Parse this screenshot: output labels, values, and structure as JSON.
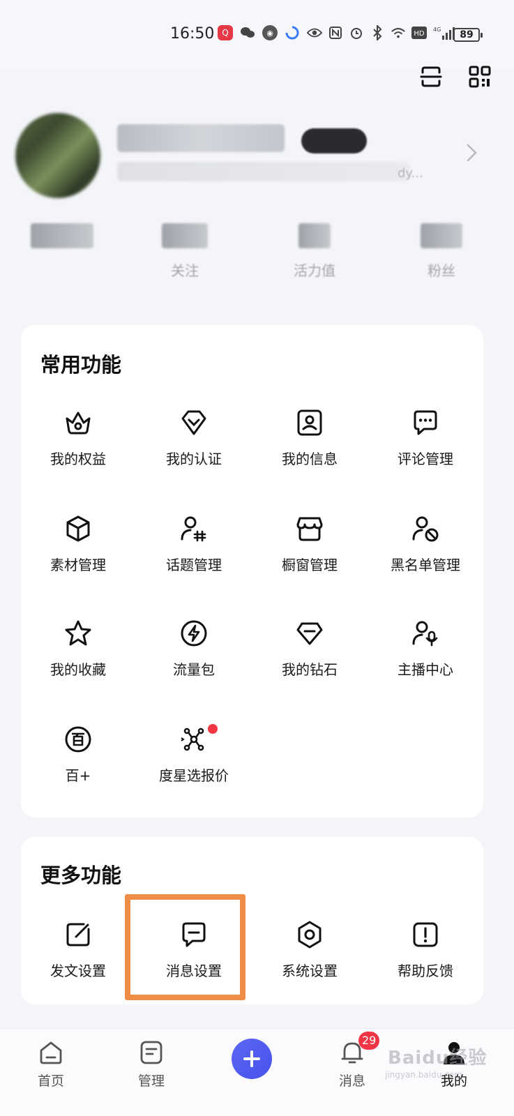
{
  "status_bar": {
    "time": "16:50",
    "battery": "89",
    "network": "4G"
  },
  "stats": [
    {
      "label": ""
    },
    {
      "label": "关注"
    },
    {
      "label": "活力值"
    },
    {
      "label": "粉丝"
    }
  ],
  "profile": {
    "bio_tail": "dy..."
  },
  "common": {
    "title": "常用功能",
    "items": [
      {
        "label": "我的权益"
      },
      {
        "label": "我的认证"
      },
      {
        "label": "我的信息"
      },
      {
        "label": "评论管理"
      },
      {
        "label": "素材管理"
      },
      {
        "label": "话题管理"
      },
      {
        "label": "橱窗管理"
      },
      {
        "label": "黑名单管理"
      },
      {
        "label": "我的收藏"
      },
      {
        "label": "流量包"
      },
      {
        "label": "我的钻石"
      },
      {
        "label": "主播中心"
      },
      {
        "label": "百+"
      },
      {
        "label": "度星选报价"
      }
    ]
  },
  "more": {
    "title": "更多功能",
    "items": [
      {
        "label": "发文设置"
      },
      {
        "label": "消息设置"
      },
      {
        "label": "系统设置"
      },
      {
        "label": "帮助反馈"
      }
    ]
  },
  "nav": {
    "home": "首页",
    "manage": "管理",
    "messages": "消息",
    "messages_badge": "29",
    "mine": "我的"
  },
  "watermark": {
    "brand": "Baidu经验",
    "url": "jingyan.baidu.com"
  },
  "colors": {
    "accent": "#4f5bf0",
    "highlight": "#ef8c45",
    "badge": "#f03545"
  }
}
